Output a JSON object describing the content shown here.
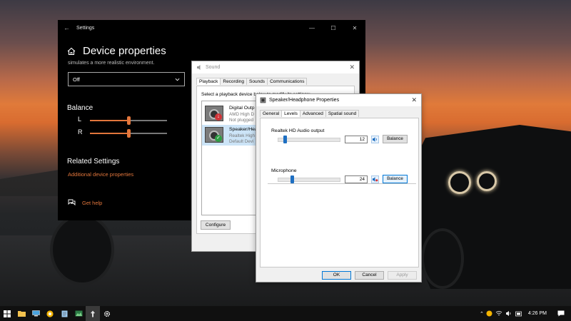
{
  "settings": {
    "window_title": "Settings",
    "page_title": "Device properties",
    "subtitle": "simulates a more realistic environment.",
    "dropdown_value": "Off",
    "balance_title": "Balance",
    "left_label": "L",
    "right_label": "R",
    "left_level_pct": 50,
    "right_level_pct": 50,
    "related_title": "Related Settings",
    "related_link": "Additional device properties",
    "help_link": "Get help"
  },
  "sound": {
    "title": "Sound",
    "tabs": [
      "Playback",
      "Recording",
      "Sounds",
      "Communications"
    ],
    "instruction": "Select a playback device below to modify its settings:",
    "devices": [
      {
        "name": "Digital Outp",
        "line2": "AMD High D",
        "line3": "Not plugged"
      },
      {
        "name": "Speaker/Hea",
        "line2": "Realtek High",
        "line3": "Default Devi"
      }
    ],
    "configure_label": "Configure"
  },
  "props": {
    "title": "Speaker/Headphone Properties",
    "tabs": [
      "General",
      "Levels",
      "Advanced",
      "Spatial sound"
    ],
    "output_label": "Realtek HD Audio output",
    "output_value": "12",
    "mic_label": "Microphone",
    "mic_value": "24",
    "balance_label": "Balance",
    "ok_label": "OK",
    "cancel_label": "Cancel",
    "apply_label": "Apply"
  },
  "taskbar": {
    "time": "4:26 PM"
  },
  "colors": {
    "accent": "#e2763c",
    "selection": "#cce4f7",
    "slider_thumb": "#1e6fc2"
  }
}
